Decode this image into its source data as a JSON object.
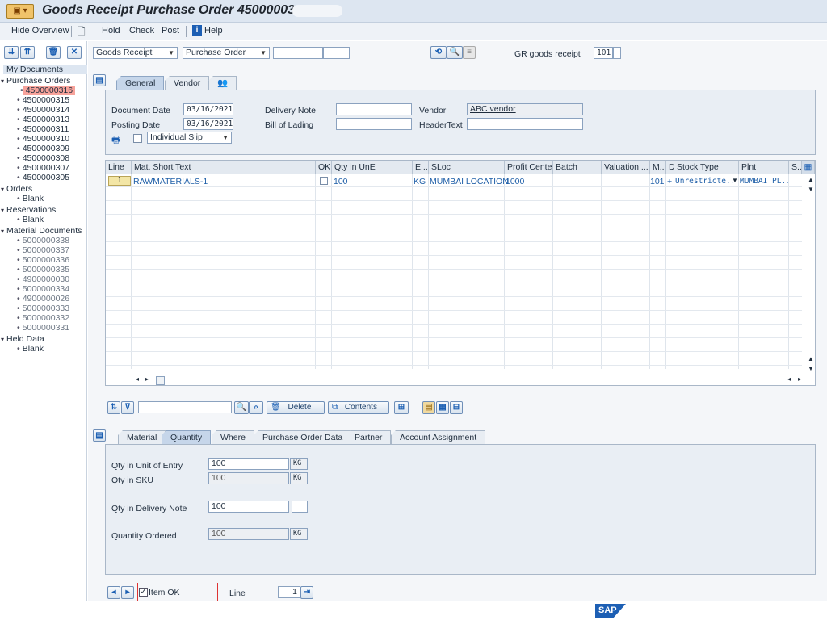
{
  "window": {
    "title": "Goods Receipt Purchase Order 4500000316 ·"
  },
  "menu": {
    "hide_overview": "Hide Overview",
    "hold": "Hold",
    "check": "Check",
    "post": "Post",
    "help": "Help"
  },
  "left_tree": {
    "header": "My Documents",
    "purchase_orders_label": "Purchase Orders",
    "purchase_orders": [
      "4500000316",
      "4500000315",
      "4500000314",
      "4500000313",
      "4500000311",
      "4500000310",
      "4500000309",
      "4500000308",
      "4500000307",
      "4500000305"
    ],
    "orders_label": "Orders",
    "orders_blank": "Blank",
    "reservations_label": "Reservations",
    "reservations_blank": "Blank",
    "material_docs_label": "Material Documents",
    "material_docs": [
      "5000000338",
      "5000000337",
      "5000000336",
      "5000000335",
      "4900000030",
      "5000000334",
      "4900000026",
      "5000000333",
      "5000000332",
      "5000000331"
    ],
    "held_data_label": "Held Data",
    "held_blank": "Blank"
  },
  "top_controls": {
    "transaction": "Goods Receipt",
    "reference": "Purchase Order",
    "gr_label": "GR goods receipt",
    "movement_type": "101"
  },
  "header_tabs": {
    "general": "General",
    "vendor": "Vendor"
  },
  "header_fields": {
    "document_date_label": "Document Date",
    "document_date": "03/16/2021",
    "posting_date_label": "Posting Date",
    "posting_date": "03/16/2021",
    "delivery_note_label": "Delivery Note",
    "delivery_note": "",
    "bill_of_lading_label": "Bill of Lading",
    "bill_of_lading": "",
    "vendor_label": "Vendor",
    "vendor": "ABC vendor",
    "header_text_label": "HeaderText",
    "header_text": "",
    "slip_option": "Individual Slip"
  },
  "grid": {
    "columns": [
      "Line",
      "Mat. Short Text",
      "OK",
      "Qty in UnE",
      "E...",
      "SLoc",
      "Profit Center",
      "Batch",
      "Valuation ...",
      "M...",
      "D",
      "Stock Type",
      "Plnt",
      "S..."
    ],
    "row": {
      "line": "1",
      "material": "RAWMATERIALS-1",
      "qty": "100",
      "unit": "KG",
      "sloc": "MUMBAI LOCATION",
      "profit_center": "1000",
      "mvt": "101",
      "d": "+",
      "stock_type": "Unrestricte...",
      "plant": "MUMBAI PL..."
    }
  },
  "detail_toolbar": {
    "delete": "Delete",
    "contents": "Contents"
  },
  "detail_tabs": [
    "Material",
    "Quantity",
    "Where",
    "Purchase Order Data",
    "Partner",
    "Account Assignment"
  ],
  "quantity": {
    "qty_unit_entry_label": "Qty in Unit of Entry",
    "qty_unit_entry": "100",
    "qty_unit_entry_uom": "KG",
    "qty_sku_label": "Qty in SKU",
    "qty_sku": "100",
    "qty_sku_uom": "KG",
    "qty_delivery_note_label": "Qty in Delivery Note",
    "qty_delivery_note": "100",
    "quantity_ordered_label": "Quantity Ordered",
    "quantity_ordered": "100",
    "quantity_ordered_uom": "KG"
  },
  "footer": {
    "item_ok": "Item OK",
    "line_label": "Line",
    "line_value": "1"
  },
  "brand": "SAP"
}
